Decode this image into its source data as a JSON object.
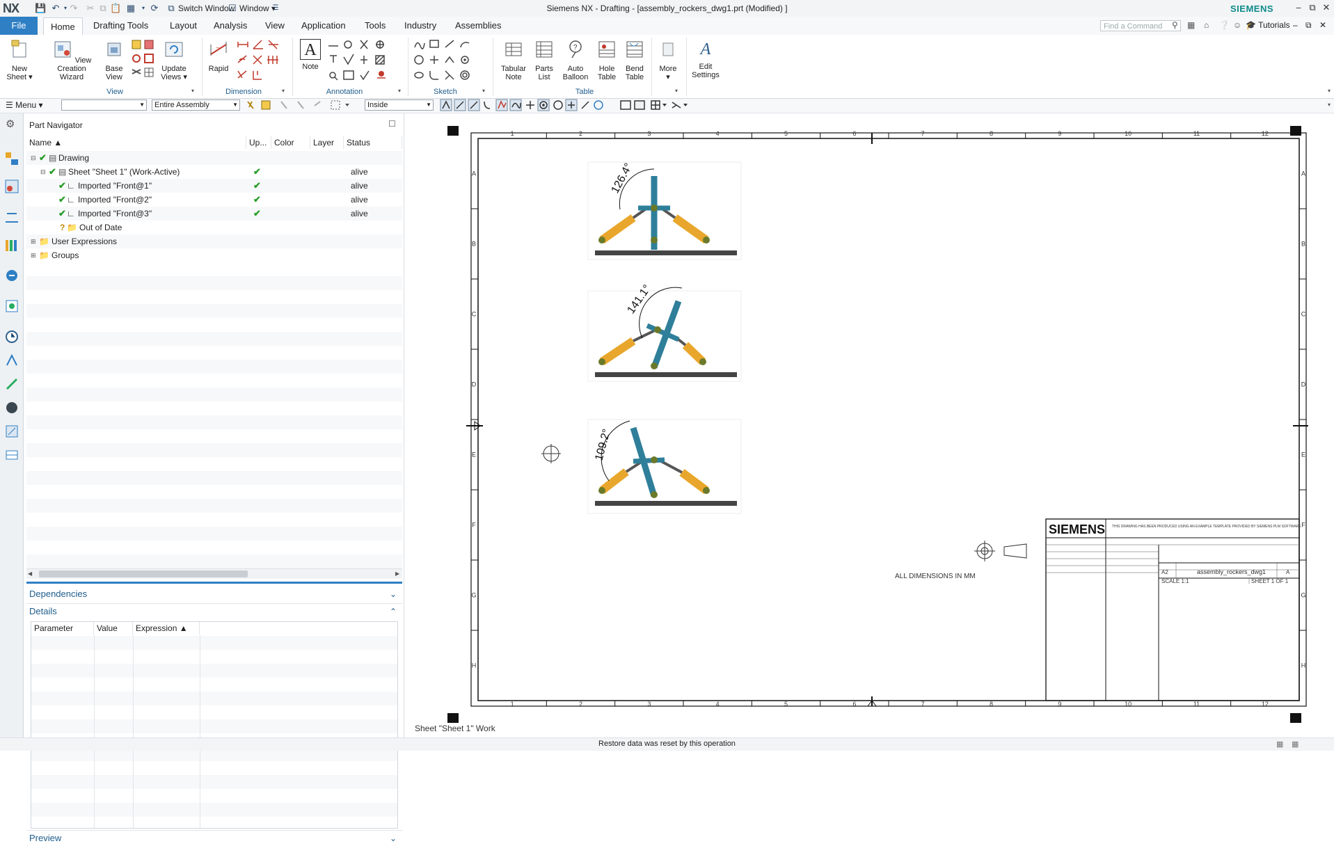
{
  "titlebar": {
    "app_logo": "NX",
    "switch_window": "Switch Window",
    "window_menu": "Window",
    "title": "Siemens NX - Drafting - [assembly_rockers_dwg1.prt (Modified) ]",
    "brand": "SIEMENS"
  },
  "tabs": {
    "file": "File",
    "items": [
      "Home",
      "Drafting Tools",
      "Layout",
      "Analysis",
      "View",
      "Application",
      "Tools",
      "Industry",
      "Assemblies"
    ],
    "find_command_placeholder": "Find a Command",
    "tutorials": "Tutorials"
  },
  "ribbon": {
    "new_sheet": "New Sheet",
    "view_creation_wizard": "View Creation Wizard",
    "base_view": "Base View",
    "update_views": "Update Views",
    "group_view": "View",
    "rapid": "Rapid",
    "group_dimension": "Dimension",
    "note": "Note",
    "group_annotation": "Annotation",
    "group_sketch": "Sketch",
    "tabular_note": "Tabular Note",
    "parts_list": "Parts List",
    "auto_balloon": "Auto Balloon",
    "hole_table": "Hole Table",
    "bend_table": "Bend Table",
    "group_table": "Table",
    "more": "More",
    "edit_settings": "Edit Settings"
  },
  "toolbar2": {
    "menu": "Menu",
    "filter_value": "",
    "assembly_scope": "Entire Assembly",
    "selection_mode": "Inside"
  },
  "navigator": {
    "title": "Part Navigator",
    "columns": [
      "Name",
      "Up...",
      "Color",
      "Layer",
      "Status"
    ],
    "rows": [
      {
        "name": "Drawing",
        "up": "",
        "status": ""
      },
      {
        "name": "Sheet \"Sheet 1\" (Work-Active)",
        "up": "✔",
        "status": "alive"
      },
      {
        "name": "Imported \"Front@1\"",
        "up": "✔",
        "status": "alive"
      },
      {
        "name": "Imported \"Front@2\"",
        "up": "✔",
        "status": "alive"
      },
      {
        "name": "Imported \"Front@3\"",
        "up": "✔",
        "status": "alive"
      },
      {
        "name": "Out of Date",
        "up": "",
        "status": ""
      },
      {
        "name": "User Expressions",
        "up": "",
        "status": ""
      },
      {
        "name": "Groups",
        "up": "",
        "status": ""
      }
    ],
    "dependencies": "Dependencies",
    "details": "Details",
    "details_columns": [
      "Parameter",
      "Value",
      "Expression"
    ],
    "preview": "Preview"
  },
  "drawing": {
    "angles": [
      "126.4°",
      "141.1°",
      "109.2°"
    ],
    "col_numbers": [
      "1",
      "2",
      "3",
      "4",
      "5",
      "6",
      "7",
      "8",
      "9",
      "10",
      "11",
      "12"
    ],
    "row_letters": [
      "A",
      "B",
      "C",
      "D",
      "E",
      "F",
      "G",
      "H"
    ],
    "all_dimensions": "ALL DIMENSIONS IN MM",
    "title_block": {
      "logo": "SIEMENS",
      "notice": "THIS DRAWING HAS BEEN PRODUCED USING AN EXAMPLE TEMPLATE PROVIDED BY SIEMENS PLM SOFTWARE",
      "size": "A2",
      "drawing_name": "assembly_rockers_dwg1",
      "rev": "A",
      "scale": "SCALE 1:1",
      "sheet": "SHEET 1 OF 1"
    },
    "sheet_label": "Sheet \"Sheet 1\" Work"
  },
  "status": {
    "message": "Restore data was reset by this operation"
  },
  "colors": {
    "accent": "#2f7fc4",
    "yellow_link": "#e8a72c",
    "teal_link": "#2f7f9a",
    "check_green": "#2a9d2a"
  }
}
